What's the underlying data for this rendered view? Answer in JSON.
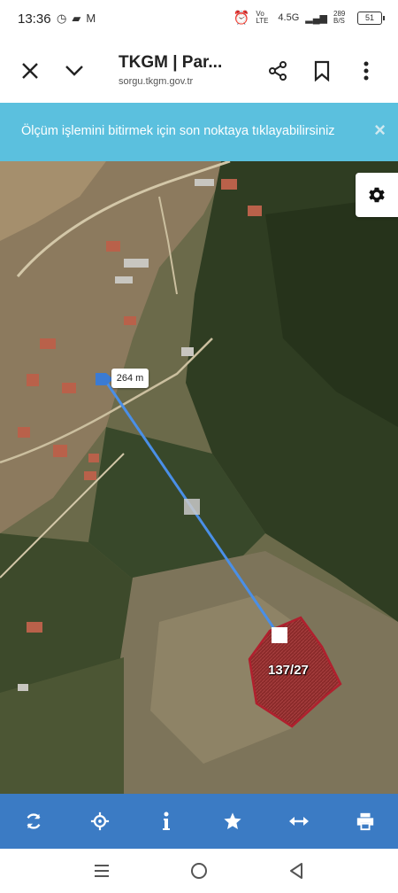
{
  "status_bar": {
    "time": "13:36",
    "network": "4.5G",
    "volte": "Vo LTE",
    "speed": "289 B/S",
    "battery": "51"
  },
  "browser": {
    "title": "TKGM | Par...",
    "url": "sorgu.tkgm.gov.tr",
    "icons": [
      "close-icon",
      "chevron-down-icon",
      "share-icon",
      "bookmark-icon",
      "more-vert-icon"
    ]
  },
  "banner": {
    "message": "Ölçüm işlemini bitirmek için son noktaya tıklayabilirsiniz",
    "close": "×"
  },
  "map": {
    "distance_label": "264 m",
    "parcel_label": "137/27",
    "line_color": "#4a8fe7",
    "parcel_color": "#b0202e"
  },
  "bottom_tools": [
    "refresh-icon",
    "locate-icon",
    "info-icon",
    "star-icon",
    "measure-icon",
    "print-icon"
  ],
  "colors": {
    "banner": "#5bc0de",
    "toolbar": "#3b7bc4"
  }
}
